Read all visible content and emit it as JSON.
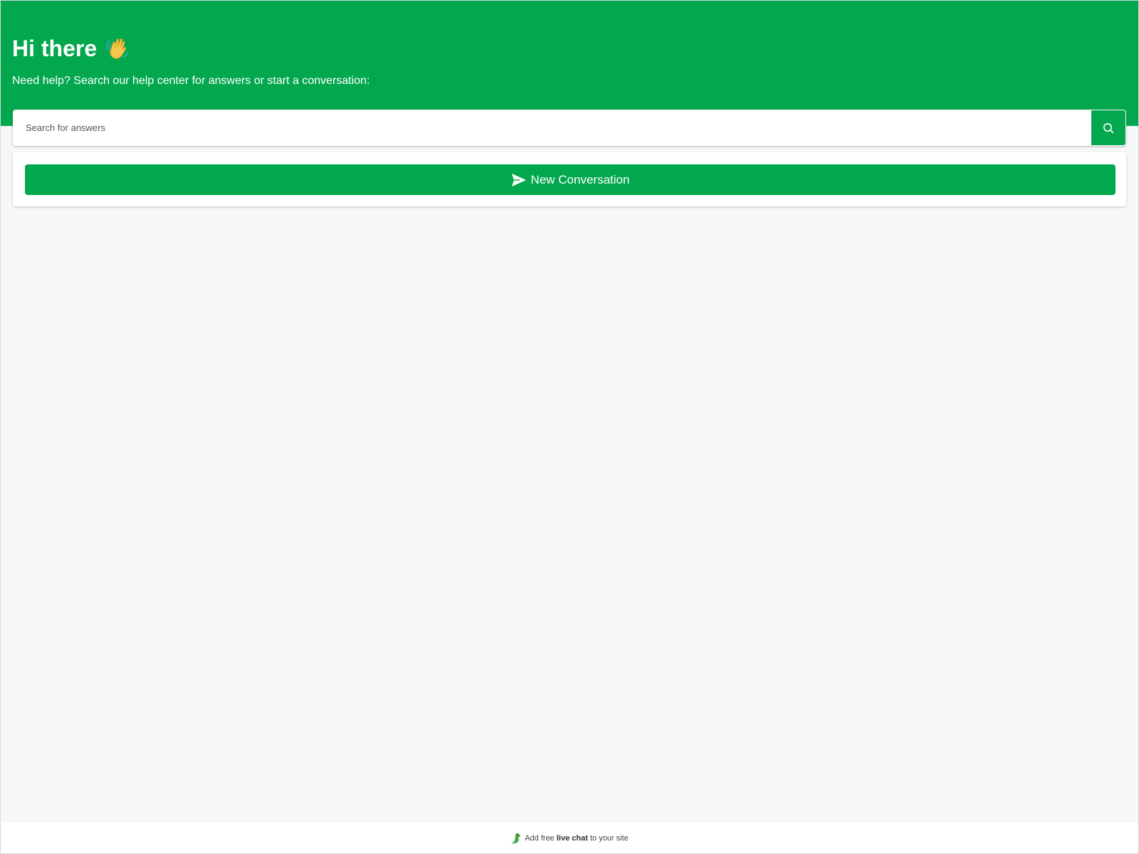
{
  "header": {
    "greeting": "Hi there",
    "greeting_emoji": "waving-hand-icon",
    "subtitle": "Need help? Search our help center for answers or start a conversation:"
  },
  "search": {
    "placeholder": "Search for answers",
    "value": "",
    "button_icon": "search-icon"
  },
  "conversation": {
    "button_label": "New Conversation",
    "button_icon": "send-icon"
  },
  "footer": {
    "icon": "parrot-logo-icon",
    "prefix": "Add free",
    "link_text": "live chat",
    "suffix": "to your site"
  },
  "colors": {
    "brand_green": "#03a84e",
    "page_background": "#f6f7f9",
    "text_on_brand": "#ffffff"
  }
}
